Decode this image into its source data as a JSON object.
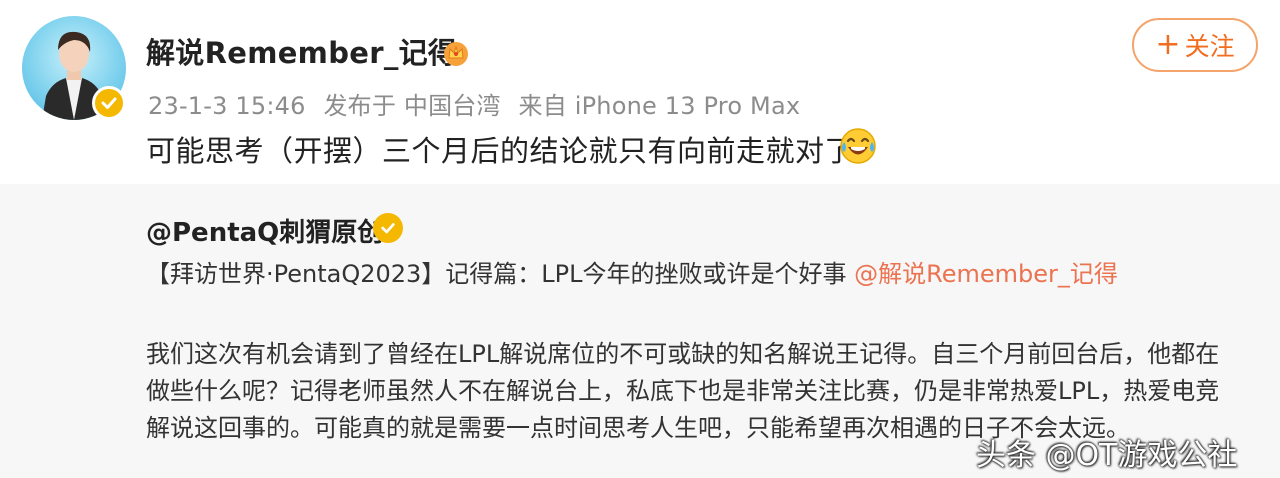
{
  "post": {
    "author": "解说Remember_记得",
    "meta": {
      "time": "23-1-3 15:46",
      "location": "发布于 中国台湾",
      "source": "来自 iPhone 13 Pro Max"
    },
    "follow_label": "关注",
    "follow_plus": "+",
    "text": "可能思考（开摆）三个月后的结论就只有向前走就对了",
    "emoji": "laughing-tears-emoji"
  },
  "repost": {
    "author": "@PentaQ刺猬原创",
    "title": "【拜访世界·PentaQ2023】记得篇：LPL今年的挫败或许是个好事",
    "mention": "@解说Remember_记得",
    "body": [
      "我们这次有机会请到了曾经在LPL解说席位的不可或缺的知名解说王记得。自三个月前回台后，他都在",
      "做些什么呢？记得老师虽然人不在解说台上，私底下也是非常关注比赛，仍是非常热爱LPL，热爱电竞",
      "解说这回事的。可能真的就是需要一点时间思考人生吧，只能希望再次相遇的日子不会太远。"
    ]
  },
  "watermark": "头条 @OT游戏公社",
  "colors": {
    "accent": "#f26d1f",
    "mention": "#eb7350",
    "verified": "#f5b800",
    "card_bg": "#f7f7f7"
  }
}
